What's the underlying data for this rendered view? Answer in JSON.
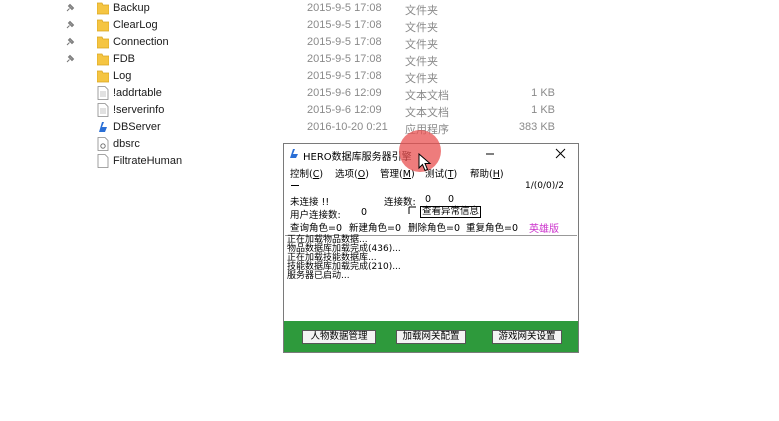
{
  "files": [
    {
      "name": "Backup",
      "date": "2015-9-5 17:08",
      "type": "文件夹",
      "size": "",
      "icon": "folder-icon",
      "pinned": true
    },
    {
      "name": "ClearLog",
      "date": "2015-9-5 17:08",
      "type": "文件夹",
      "size": "",
      "icon": "folder-icon",
      "pinned": true
    },
    {
      "name": "Connection",
      "date": "2015-9-5 17:08",
      "type": "文件夹",
      "size": "",
      "icon": "folder-icon",
      "pinned": true
    },
    {
      "name": "FDB",
      "date": "2015-9-5 17:08",
      "type": "文件夹",
      "size": "",
      "icon": "folder-icon",
      "pinned": true
    },
    {
      "name": "Log",
      "date": "2015-9-5 17:08",
      "type": "文件夹",
      "size": "",
      "icon": "folder-icon",
      "pinned": false
    },
    {
      "name": "!addrtable",
      "date": "2015-9-6 12:09",
      "type": "文本文档",
      "size": "1 KB",
      "icon": "text-file-icon",
      "pinned": false
    },
    {
      "name": "!serverinfo",
      "date": "2015-9-6 12:09",
      "type": "文本文档",
      "size": "1 KB",
      "icon": "text-file-icon",
      "pinned": false
    },
    {
      "name": "DBServer",
      "date": "2016-10-20 0:21",
      "type": "应用程序",
      "size": "383 KB",
      "icon": "app-icon",
      "pinned": false
    },
    {
      "name": "dbsrc",
      "date": "",
      "type": "",
      "size": "",
      "icon": "settings-file-icon",
      "pinned": false
    },
    {
      "name": "FiltrateHuman",
      "date": "",
      "type": "",
      "size": "",
      "icon": "file-icon",
      "pinned": false
    }
  ],
  "window": {
    "title": "HERO数据库服务器引擎",
    "minimize_symbol": "—",
    "close_symbol": "✕",
    "menu": [
      {
        "label": "控制",
        "key": "C"
      },
      {
        "label": "选项",
        "key": "O"
      },
      {
        "label": "管理",
        "key": "M"
      },
      {
        "label": "测试",
        "key": "T"
      },
      {
        "label": "帮助",
        "key": "H"
      }
    ],
    "counter": "1/(0/0)/2",
    "status_line1": "未连接 !!",
    "conn_label": "连接数:",
    "conn_a": "0",
    "conn_b": "0",
    "user_conn_label": "用户连接数:",
    "user_conn_value": "0",
    "view_errors_label": "查看异常信息",
    "query_roles": "查询角色=0",
    "new_roles": "新建角色=0",
    "delete_roles": "删除角色=0",
    "duplicate_roles": "重复角色=0",
    "edition": "英雄版",
    "log_lines": [
      "正在加载物品数据...",
      "物品数据库加载完成(436)...",
      "正在加载技能数据库...",
      "技能数据库加载完成(210)...",
      "服务器已启动..."
    ],
    "buttons": {
      "character_data": "人物数据管理",
      "load_gateway": "加载网关配置",
      "game_gateway": "游戏网关设置"
    }
  },
  "colors": {
    "bottom_bar": "#2e9a3c",
    "edition_text": "#cc33cc",
    "click_indicator": "#e85050"
  }
}
